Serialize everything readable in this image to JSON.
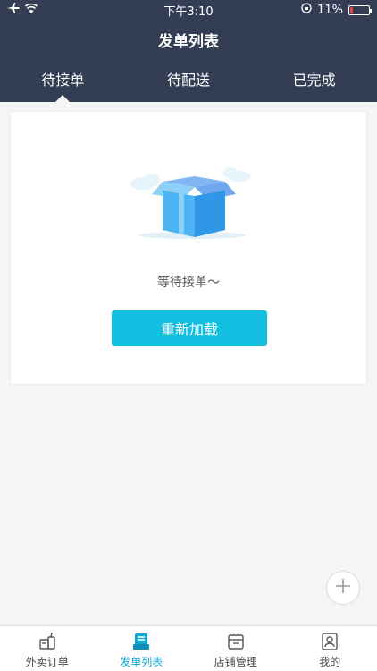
{
  "status_bar": {
    "time": "下午3:10",
    "battery": "11%"
  },
  "title": "发单列表",
  "tabs": [
    {
      "label": "待接单"
    },
    {
      "label": "待配送"
    },
    {
      "label": "已完成"
    }
  ],
  "empty_state": {
    "message": "等待接单～",
    "reload_label": "重新加载"
  },
  "bottom_nav": [
    {
      "label": "外卖订单",
      "icon": "takeout-cup-icon"
    },
    {
      "label": "发单列表",
      "icon": "order-list-icon"
    },
    {
      "label": "店铺管理",
      "icon": "store-icon"
    },
    {
      "label": "我的",
      "icon": "profile-icon"
    }
  ],
  "colors": {
    "header": "#333d54",
    "accent": "#12bfe0",
    "active_nav": "#12a8d6"
  }
}
